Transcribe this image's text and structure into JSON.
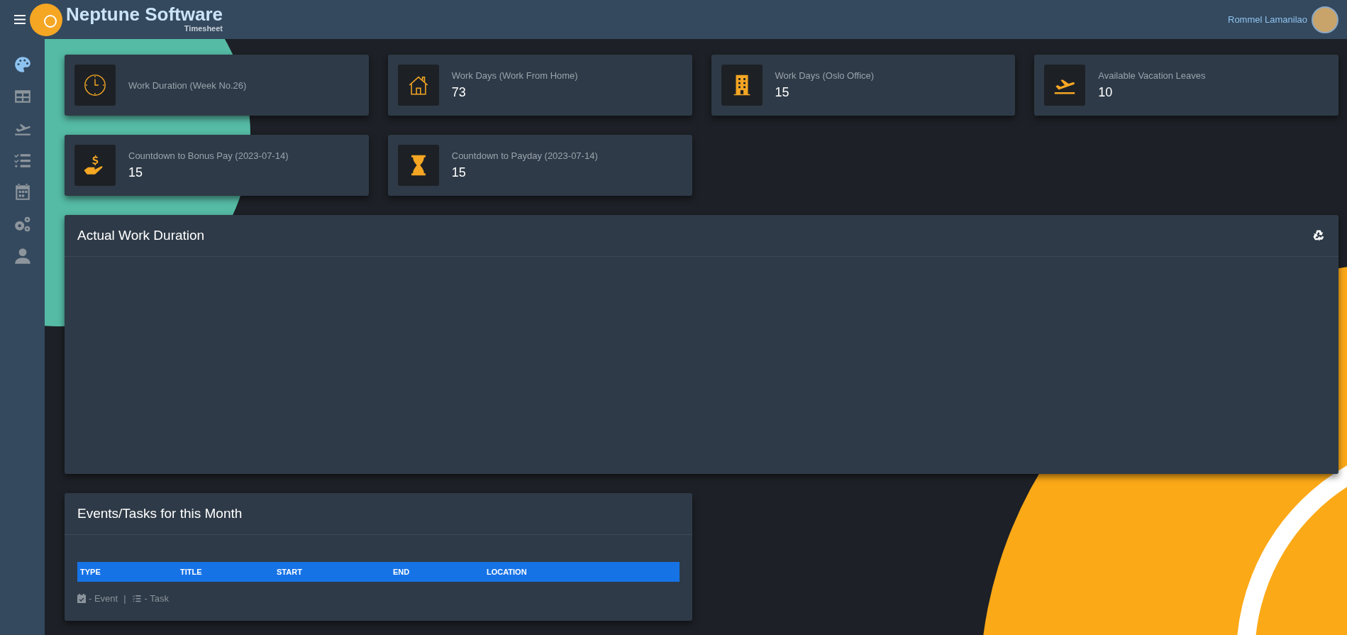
{
  "topbar": {
    "brand": "Neptune Software",
    "subtitle": "Timesheet",
    "user_name": "Rommel Lamanilao"
  },
  "sidebar": {
    "items": [
      {
        "kind": "palette",
        "selected": true
      },
      {
        "kind": "table",
        "selected": false
      },
      {
        "kind": "plane",
        "selected": false
      },
      {
        "kind": "tasks",
        "selected": false
      },
      {
        "kind": "calendar",
        "selected": false
      },
      {
        "kind": "gears",
        "selected": false
      },
      {
        "kind": "user",
        "selected": false
      }
    ]
  },
  "cards": [
    {
      "kind": "clock",
      "label": "Work Duration (Week No.26)"
    },
    {
      "kind": "house",
      "label": "Work Days (Work From Home)",
      "value": "73"
    },
    {
      "kind": "building",
      "label": "Work Days (Oslo Office)",
      "value": "15"
    },
    {
      "kind": "plane",
      "label": "Available Vacation Leaves",
      "value": "10"
    },
    {
      "kind": "money",
      "label": "Countdown to Bonus Pay (2023-07-14)",
      "value": "15"
    },
    {
      "kind": "hourglass",
      "label": "Countdown to Payday (2023-07-14)",
      "value": "15"
    }
  ],
  "work_panel": {
    "title": "Actual Work Duration"
  },
  "events_panel": {
    "title": "Events/Tasks for this Month",
    "table": {
      "columns": [
        "TYPE",
        "TITLE",
        "START",
        "END",
        "LOCATION"
      ]
    },
    "legend": [
      {
        "kind": "event",
        "text": "- Event"
      },
      {
        "kind": "task",
        "text": "- Task"
      }
    ],
    "separator": "|"
  }
}
